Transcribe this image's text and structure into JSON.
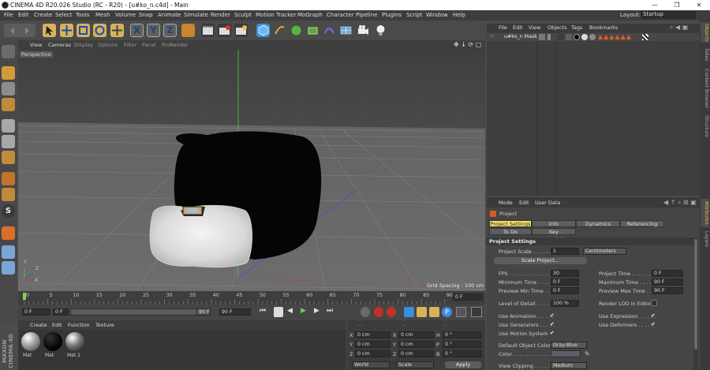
{
  "window": {
    "title": "CINEMA 4D R20.026 Studio (RC - R20) - [u#ko_n.c4d] - Main",
    "controls": [
      "—",
      "❐",
      "✕"
    ]
  },
  "menu": [
    "File",
    "Edit",
    "Create",
    "Select",
    "Tools",
    "Mesh",
    "Volume",
    "Snap",
    "Animate",
    "Simulate",
    "Render",
    "Sculpt",
    "Motion Tracker",
    "MoGraph",
    "Character",
    "Pipeline",
    "Plugins",
    "Script",
    "Window",
    "Help"
  ],
  "layout": {
    "label": "Layout:",
    "value": "Startup"
  },
  "toolbar": {
    "axes": [
      "X",
      "Y",
      "Z"
    ]
  },
  "viewport": {
    "menu": [
      "View",
      "Cameras",
      "Display",
      "Options",
      "Filter",
      "Panel",
      "ProRender"
    ],
    "label": "Perspective",
    "grid_spacing": "Grid Spacing : 100 cm",
    "axis_labels": {
      "y": "Y",
      "z": "Z",
      "x": "X"
    }
  },
  "timeline": {
    "ticks": [
      "0",
      "5",
      "10",
      "15",
      "20",
      "25",
      "30",
      "35",
      "40",
      "45",
      "50",
      "55",
      "60",
      "65",
      "70",
      "75",
      "80",
      "85",
      "90"
    ],
    "frame_end_label": "0 F"
  },
  "time_controls": {
    "start": "0 F",
    "preview_min": "0 F",
    "preview_max": "90 F",
    "end": "90 F"
  },
  "material_manager": {
    "menu": [
      "Create",
      "Edit",
      "Function",
      "Texture"
    ],
    "materials": [
      "Mat",
      "Mat",
      "Mat.1"
    ],
    "brand": "MAXON CINEMA 4D"
  },
  "coordinates": {
    "header": [
      "--",
      "--",
      "--"
    ],
    "rows": [
      {
        "a": "X",
        "a_val": "0 cm",
        "b": "X",
        "b_val": "0 cm",
        "c": "H",
        "c_val": "0 °"
      },
      {
        "a": "Y",
        "a_val": "0 cm",
        "b": "Y",
        "b_val": "0 cm",
        "c": "P",
        "c_val": "0 °"
      },
      {
        "a": "Z",
        "a_val": "0 cm",
        "b": "Z",
        "b_val": "0 cm",
        "c": "B",
        "c_val": "0 °"
      }
    ],
    "mode1": "World",
    "mode2": "Scale",
    "apply": "Apply"
  },
  "object_manager": {
    "menu": [
      "File",
      "Edit",
      "View",
      "Objects",
      "Tags",
      "Bookmarks"
    ],
    "objects": [
      {
        "name": "u#ko_n Mask"
      }
    ]
  },
  "attribute_manager": {
    "menu": [
      "Mode",
      "Edit",
      "User Data"
    ],
    "object_type": "Project",
    "tabs_row1": [
      "Project Settings",
      "Info",
      "Dynamics",
      "Referencing"
    ],
    "tabs_row2": [
      "To Do",
      "Key Interpolation"
    ],
    "section": "Project Settings",
    "project_scale_label": "Project Scale . . . . . .",
    "project_scale_value": "1",
    "project_scale_unit": "Centimeters",
    "scale_project_btn": "Scale Project...",
    "fps_label": "FPS . . . . . . . . . . . . . .",
    "fps_value": "30",
    "project_time_label": "Project Time . . . . . . .",
    "project_time_value": "0 F",
    "min_time_label": "Minimum Time . . . . . .",
    "min_time_value": "0 F",
    "max_time_label": "Maximum Time . . . . .",
    "max_time_value": "90 F",
    "prev_min_label": "Preview Min Time . . .",
    "prev_min_value": "0 F",
    "prev_max_label": "Preview Max Time . . .",
    "prev_max_value": "90 F",
    "lod_label": "Level of Detail . . . . . .",
    "lod_value": "100 %",
    "render_lod_label": "Render LOD in Editor",
    "use_anim_label": "Use Animation. . . . . .",
    "use_expr_label": "Use Expression. . . . . .",
    "use_gen_label": "Use Generators . . . . .",
    "use_deform_label": "Use Deformers . . . . .",
    "use_motion_label": "Use Motion System",
    "default_color_label": "Default Object Color",
    "default_color_value": "Gray-Blue",
    "color_label": "Color . . . . . . . . . . . . .",
    "view_clipping_label": "View Clipping . . . . . .",
    "view_clipping_value": "Medium"
  },
  "side_tabs": [
    "Objects",
    "Takes",
    "Content Browser",
    "Structure"
  ],
  "side_tabs_bottom": [
    "Attributes",
    "Layers"
  ],
  "colors": {
    "accent": "#f0d65a",
    "selected_tab": "#f7de68"
  }
}
